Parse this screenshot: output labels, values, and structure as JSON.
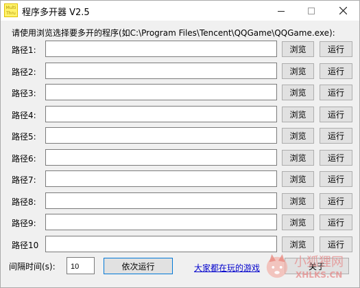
{
  "window": {
    "title": "程序多开器 V2.5",
    "icon_text": "Multi Thru"
  },
  "instruction": "请使用浏览选择要多开的程序(如C:\\Program Files\\Tencent\\QQGame\\QQGame.exe):",
  "rows": [
    {
      "label": "路径1:",
      "value": "",
      "browse": "浏览",
      "run": "运行"
    },
    {
      "label": "路径2:",
      "value": "",
      "browse": "浏览",
      "run": "运行"
    },
    {
      "label": "路径3:",
      "value": "",
      "browse": "浏览",
      "run": "运行"
    },
    {
      "label": "路径4:",
      "value": "",
      "browse": "浏览",
      "run": "运行"
    },
    {
      "label": "路径5:",
      "value": "",
      "browse": "浏览",
      "run": "运行"
    },
    {
      "label": "路径6:",
      "value": "",
      "browse": "浏览",
      "run": "运行"
    },
    {
      "label": "路径7:",
      "value": "",
      "browse": "浏览",
      "run": "运行"
    },
    {
      "label": "路径8:",
      "value": "",
      "browse": "浏览",
      "run": "运行"
    },
    {
      "label": "路径9:",
      "value": "",
      "browse": "浏览",
      "run": "运行"
    },
    {
      "label": "路径10",
      "value": "",
      "browse": "浏览",
      "run": "运行"
    }
  ],
  "footer": {
    "interval_label": "间隔时间(s):",
    "interval_value": "10",
    "run_all": "依次运行",
    "link": "大家都在玩的游戏",
    "about": "关于"
  },
  "watermark": {
    "cn": "小狐狸网",
    "en": "XHLKS.CN"
  },
  "colors": {
    "link": "#0000cc",
    "focus_border": "#0078d7",
    "watermark": "#e58a8a"
  },
  "icons": [
    "app-icon",
    "minimize-icon",
    "maximize-icon",
    "close-icon",
    "fox-logo-icon"
  ]
}
